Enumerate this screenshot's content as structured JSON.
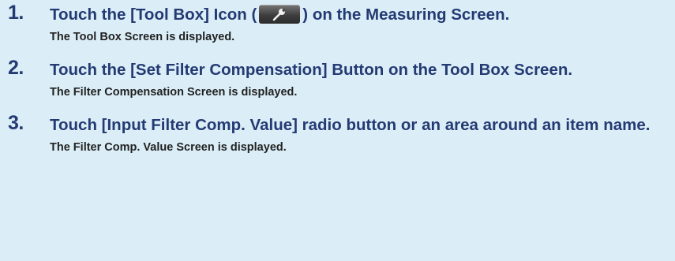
{
  "steps": [
    {
      "number": "1.",
      "title_before_icon": "Touch the [Tool Box] Icon (",
      "title_after_icon": ") on the Measuring Screen.",
      "icon": "wrench-icon",
      "description": "The Tool Box Screen is displayed."
    },
    {
      "number": "2.",
      "title": "Touch the [Set Filter Compensation] Button on the Tool Box Screen.",
      "description": "The Filter Compensation Screen is displayed."
    },
    {
      "number": "3.",
      "title": "Touch [Input Filter Comp. Value] radio button or an area around an item name.",
      "description": "The Filter Comp. Value Screen is displayed."
    }
  ]
}
